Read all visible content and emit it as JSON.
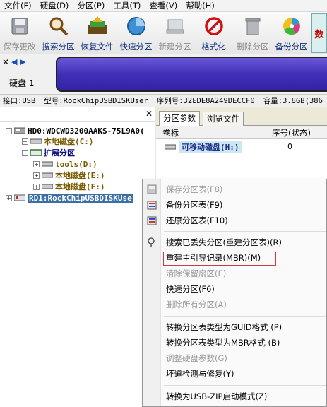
{
  "menubar": [
    "文件(F)",
    "硬盘(D)",
    "分区(P)",
    "工具(T)",
    "查看(V)",
    "帮助(H)"
  ],
  "toolbar": [
    {
      "label": "保存更改",
      "icon": "save-icon",
      "disabled": true
    },
    {
      "label": "搜索分区",
      "icon": "magnifier-icon",
      "disabled": false
    },
    {
      "label": "恢复文件",
      "icon": "recover-files-icon",
      "disabled": false
    },
    {
      "label": "快速分区",
      "icon": "quick-partition-icon",
      "disabled": false
    },
    {
      "label": "新建分区",
      "icon": "new-partition-icon",
      "disabled": true
    },
    {
      "label": "格式化",
      "icon": "format-icon",
      "disabled": false
    },
    {
      "label": "删除分区",
      "icon": "trash-icon",
      "disabled": true
    },
    {
      "label": "备份分区",
      "icon": "backup-partition-icon",
      "disabled": false
    }
  ],
  "toolbar_edge_text": "数",
  "disk_panel": {
    "label": "硬盘 1"
  },
  "info": {
    "interface": "接口:USB",
    "model": "型号:RockChipUSBDISKUser",
    "serial": "序列号:32EDE8A249DECCF0",
    "capacity": "容量:3.8GB(386"
  },
  "tree": {
    "hd0": "HD0:WDCWD3200AAKS-75L9A0(",
    "local_c": "本地磁盘(C:)",
    "extended": "扩展分区",
    "tools": "tools(D:)",
    "local_e": "本地磁盘(E:)",
    "local_f": "本地磁盘(F:)",
    "rd1": "RD1:RockChipUSBDISKUse"
  },
  "tabs": [
    "分区参数",
    "浏览文件"
  ],
  "grid": {
    "col_label": "卷标",
    "col_seq": "序号(状态)",
    "row_name": "可移动磁盘(H:)",
    "row_seq": "0"
  },
  "context_menu": [
    {
      "label": "保存分区表(F8)",
      "disabled": true,
      "icon": "save-table-icon"
    },
    {
      "label": "备份分区表(F9)",
      "disabled": false,
      "icon": "backup-table-icon"
    },
    {
      "label": "还原分区表(F10)",
      "disabled": false,
      "icon": "restore-table-icon"
    },
    {
      "label": "搜索已丢失分区(重建分区表)(R)",
      "disabled": false,
      "icon": "search-lost-icon"
    },
    {
      "label": "重建主引导记录(MBR)(M)",
      "disabled": false,
      "icon": ""
    },
    {
      "label": "清除保留扇区(E)",
      "disabled": true,
      "icon": ""
    },
    {
      "label": "快速分区(F6)",
      "disabled": false,
      "icon": ""
    },
    {
      "label": "删除所有分区(A)",
      "disabled": true,
      "icon": ""
    },
    {
      "label": "转换分区表类型为GUID格式 (P)",
      "disabled": false,
      "icon": ""
    },
    {
      "label": "转换分区表类型为MBR格式 (B)",
      "disabled": false,
      "icon": ""
    },
    {
      "label": "调整硬盘参数(G)",
      "disabled": true,
      "icon": ""
    },
    {
      "label": "坏道检测与修复(Y)",
      "disabled": false,
      "icon": ""
    },
    {
      "label": "转换为USB-ZIP启动模式(Z)",
      "disabled": false,
      "icon": ""
    }
  ],
  "colors": {
    "accent_highlight": "#d23b3b",
    "disk_graph": "#4a3ac8",
    "selection": "#3a6ea5"
  }
}
